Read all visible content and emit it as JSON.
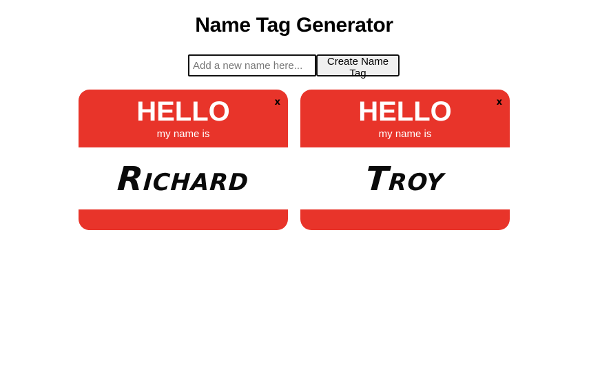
{
  "header": {
    "title": "Name Tag Generator"
  },
  "form": {
    "input_placeholder": "Add a new name here...",
    "input_value": "",
    "button_label": "Create Name Tag"
  },
  "tags": [
    {
      "hello": "HELLO",
      "subtitle": "my name is",
      "name": "Richard",
      "close": "x"
    },
    {
      "hello": "HELLO",
      "subtitle": "my name is",
      "name": "Troy",
      "close": "x"
    }
  ],
  "colors": {
    "tag_red": "#e8342a",
    "tag_white": "#ffffff"
  }
}
